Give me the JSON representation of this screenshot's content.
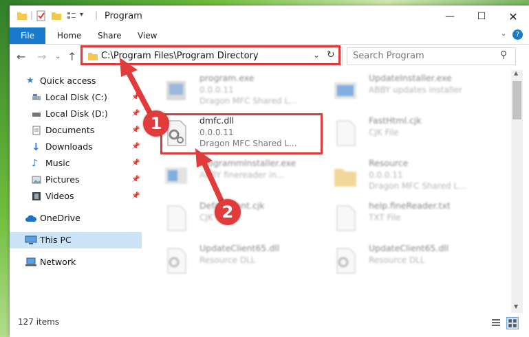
{
  "window": {
    "title": "Program"
  },
  "ribbon": {
    "tabs": [
      "File",
      "Home",
      "Share",
      "View"
    ]
  },
  "address": {
    "path": "C:\\Program Files\\Program Directory"
  },
  "search": {
    "placeholder": "Search Program"
  },
  "sidebar": {
    "items": [
      {
        "label": "Quick access",
        "icon": "star-icon"
      },
      {
        "label": "Local Disk (C:)",
        "icon": "drive-icon"
      },
      {
        "label": "Local Disk (D:)",
        "icon": "drive-icon"
      },
      {
        "label": "Documents",
        "icon": "documents-icon"
      },
      {
        "label": "Downloads",
        "icon": "download-icon"
      },
      {
        "label": "Music",
        "icon": "music-icon"
      },
      {
        "label": "Pictures",
        "icon": "pictures-icon"
      },
      {
        "label": "Videos",
        "icon": "videos-icon"
      },
      {
        "label": "OneDrive",
        "icon": "cloud-icon"
      },
      {
        "label": "This PC",
        "icon": "computer-icon"
      },
      {
        "label": "Network",
        "icon": "network-icon"
      }
    ]
  },
  "files": [
    {
      "name": "program.exe",
      "line2": "0.0.0.11",
      "line3": "Dragon MFC Shared L..."
    },
    {
      "name": "UpdateInstaller.exe",
      "line2": "ABBY updates installer",
      "line3": ""
    },
    {
      "name": "dmfc.dll",
      "line2": "0.0.0.11",
      "line3": "Dragon MFC Shared L..."
    },
    {
      "name": "FastHtml.cjk",
      "line2": "CJK File",
      "line3": ""
    },
    {
      "name": "ProgrammInstaller.exe",
      "line2": "ABBY finereader in...",
      "line3": ""
    },
    {
      "name": "Resource",
      "line2": "0.0.0.11",
      "line3": "Dragon MFC Shared L..."
    },
    {
      "name": "DefaultFont.cjk",
      "line2": "CJK File",
      "line3": ""
    },
    {
      "name": "help.fineReader.txt",
      "line2": "TXT File",
      "line3": ""
    },
    {
      "name": "UpdateClient65.dll",
      "line2": "Resource DLL",
      "line3": ""
    },
    {
      "name": "UpdateClient65.dll",
      "line2": "Resource DLL",
      "line3": ""
    }
  ],
  "status": {
    "count": "127 items"
  },
  "annotations": {
    "badge1": "1",
    "badge2": "2",
    "accent": "#e23b3b"
  }
}
